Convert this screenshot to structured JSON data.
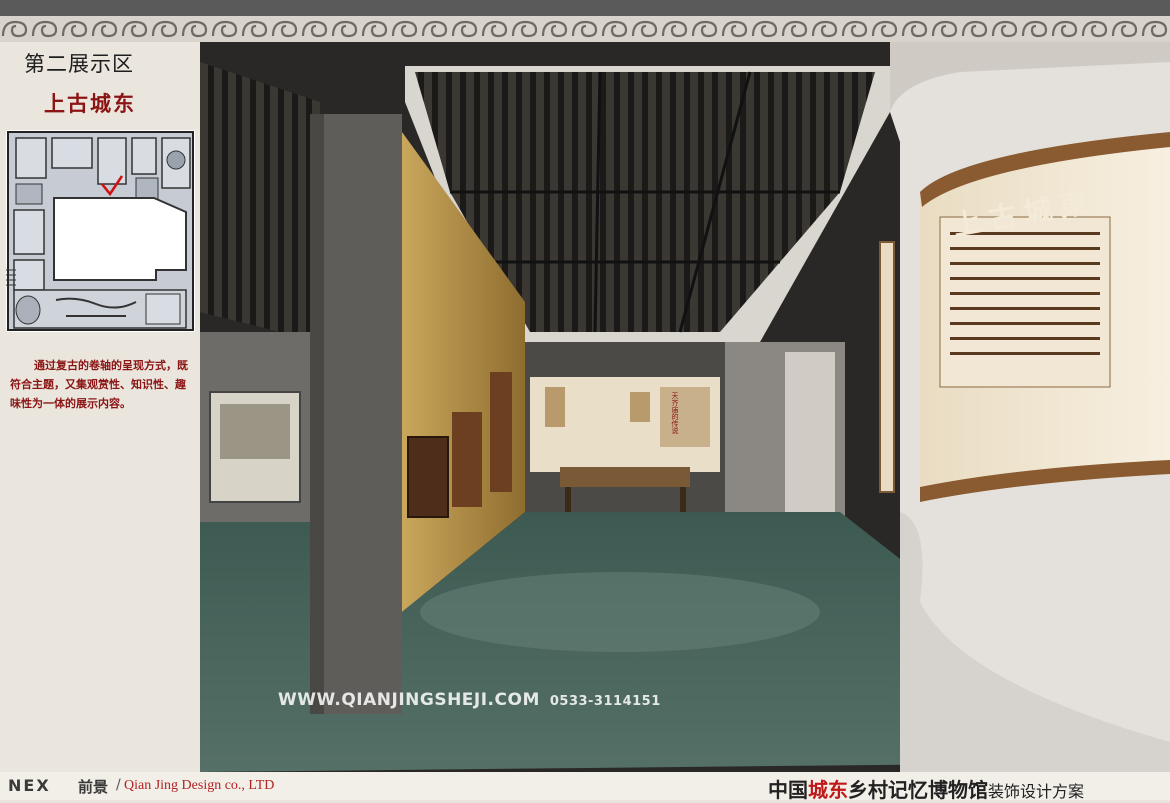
{
  "left_panel": {
    "zone_title": "第二展示区",
    "sub_title": "上古城东",
    "description": "通过复古的卷轴的呈现方式，既符合主题，又集观赏性、知识性、趣味性为一体的展示内容。"
  },
  "render": {
    "watermark_url": "WWW.QIANJINGSHEJI.COM",
    "watermark_phone": "0533-3114151",
    "scroll_title": "上古城東",
    "panel_title": "天齐庙的传说"
  },
  "footer": {
    "brand_logo": "NEX",
    "brand_cn": "前景",
    "separator": "/",
    "company": "Qian Jing Design co., LTD",
    "project_part1": "中国",
    "project_part2": "城东",
    "project_part3": "乡村记忆博物馆",
    "project_part4": "装饰设计方案"
  },
  "colors": {
    "accent_red": "#8b1414",
    "frame_gray": "#5a5a5a",
    "panel_bg": "#eae6dd"
  },
  "icons": [
    "location-marker-icon"
  ]
}
